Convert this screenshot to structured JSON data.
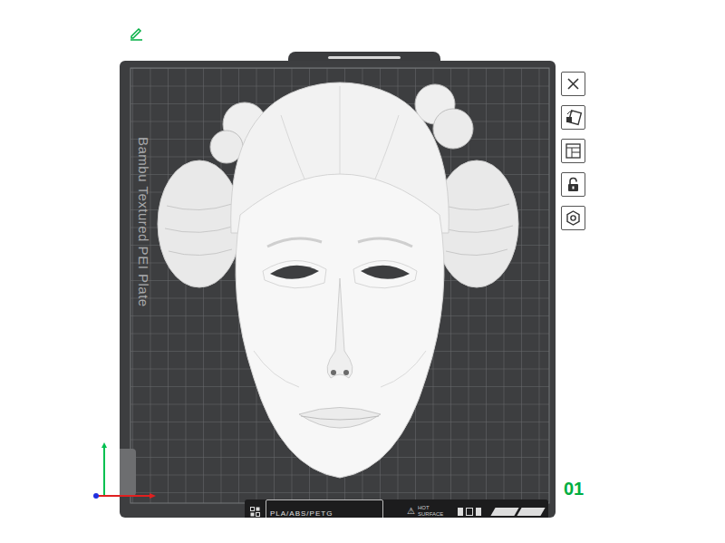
{
  "plate": {
    "name": "Bambu Textured PEI Plate",
    "number": "01",
    "filament": "PLA/ABS/PETG",
    "warning_icon": "⚠",
    "warning": "HOT SURFACE",
    "locked": false
  }
}
